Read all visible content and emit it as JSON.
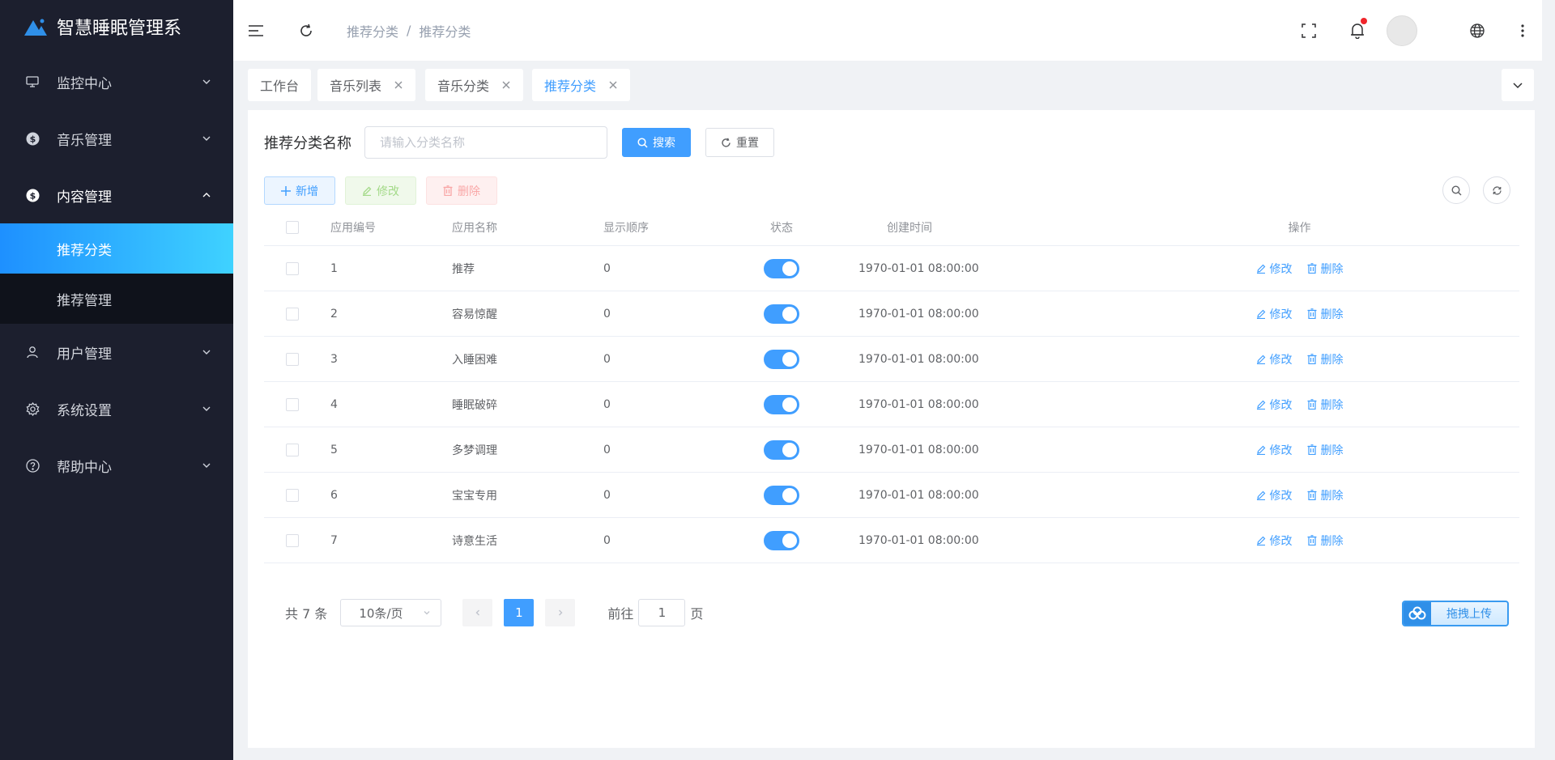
{
  "app": {
    "title": "智慧睡眠管理系"
  },
  "sidebar": {
    "items": [
      {
        "label": "监控中心",
        "icon": "monitor-icon"
      },
      {
        "label": "音乐管理",
        "icon": "dollar-circle-icon"
      },
      {
        "label": "内容管理",
        "icon": "dollar-circle-icon",
        "expanded": true,
        "children": [
          {
            "label": "推荐分类",
            "active": true
          },
          {
            "label": "推荐管理"
          }
        ]
      },
      {
        "label": "用户管理",
        "icon": "user-icon"
      },
      {
        "label": "系统设置",
        "icon": "gear-icon"
      },
      {
        "label": "帮助中心",
        "icon": "question-circle-icon"
      }
    ]
  },
  "header": {
    "breadcrumb": [
      "推荐分类",
      "推荐分类"
    ],
    "breadcrumb_sep": "/"
  },
  "tags": [
    {
      "label": "工作台"
    },
    {
      "label": "音乐列表"
    },
    {
      "label": "音乐分类"
    },
    {
      "label": "推荐分类",
      "active": true
    }
  ],
  "search": {
    "label": "推荐分类名称",
    "placeholder": "请输入分类名称",
    "search_btn": "搜索",
    "reset_btn": "重置"
  },
  "toolbar": {
    "add": "新增",
    "edit": "修改",
    "delete": "删除"
  },
  "table": {
    "columns": [
      "应用编号",
      "应用名称",
      "显示顺序",
      "状态",
      "创建时间",
      "操作"
    ],
    "rows": [
      {
        "id": "1",
        "name": "推荐",
        "order": "0",
        "enabled": true,
        "time": "1970-01-01 08:00:00"
      },
      {
        "id": "2",
        "name": "容易惊醒",
        "order": "0",
        "enabled": true,
        "time": "1970-01-01 08:00:00"
      },
      {
        "id": "3",
        "name": "入睡困难",
        "order": "0",
        "enabled": true,
        "time": "1970-01-01 08:00:00"
      },
      {
        "id": "4",
        "name": "睡眠破碎",
        "order": "0",
        "enabled": true,
        "time": "1970-01-01 08:00:00"
      },
      {
        "id": "5",
        "name": "多梦调理",
        "order": "0",
        "enabled": true,
        "time": "1970-01-01 08:00:00"
      },
      {
        "id": "6",
        "name": "宝宝专用",
        "order": "0",
        "enabled": true,
        "time": "1970-01-01 08:00:00"
      },
      {
        "id": "7",
        "name": "诗意生活",
        "order": "0",
        "enabled": true,
        "time": "1970-01-01 08:00:00"
      }
    ],
    "op_edit": "修改",
    "op_delete": "删除"
  },
  "pagination": {
    "total": "共 7 条",
    "page_size": "10条/页",
    "current": "1",
    "goto_prefix": "前往",
    "goto_value": "1",
    "goto_suffix": "页"
  },
  "upload": {
    "label": "拖拽上传"
  },
  "colors": {
    "primary": "#409eff",
    "sidebar_bg": "#1c1f2e",
    "active_gradient_start": "#1e90ff",
    "active_gradient_end": "#3fd2ff"
  }
}
